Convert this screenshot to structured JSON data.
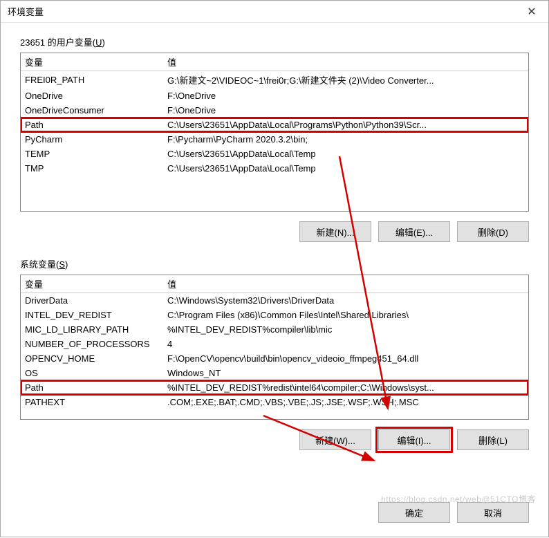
{
  "window": {
    "title": "环境变量"
  },
  "user_section": {
    "label_prefix": "23651 的用户变量(",
    "label_hotkey": "U",
    "label_suffix": ")",
    "header_var": "变量",
    "header_val": "值",
    "rows": [
      {
        "var": "FREI0R_PATH",
        "val": "G:\\新建文~2\\VIDEOC~1\\frei0r;G:\\新建文件夹 (2)\\Video Converter...",
        "hl": false
      },
      {
        "var": "OneDrive",
        "val": "F:\\OneDrive",
        "hl": false
      },
      {
        "var": "OneDriveConsumer",
        "val": "F:\\OneDrive",
        "hl": false
      },
      {
        "var": "Path",
        "val": "C:\\Users\\23651\\AppData\\Local\\Programs\\Python\\Python39\\Scr...",
        "hl": true
      },
      {
        "var": "PyCharm",
        "val": "F:\\Pycharm\\PyCharm 2020.3.2\\bin;",
        "hl": false
      },
      {
        "var": "TEMP",
        "val": "C:\\Users\\23651\\AppData\\Local\\Temp",
        "hl": false
      },
      {
        "var": "TMP",
        "val": "C:\\Users\\23651\\AppData\\Local\\Temp",
        "hl": false
      }
    ],
    "btn_new": "新建(N)...",
    "btn_edit": "编辑(E)...",
    "btn_delete": "删除(D)"
  },
  "sys_section": {
    "label_prefix": "系统变量(",
    "label_hotkey": "S",
    "label_suffix": ")",
    "header_var": "变量",
    "header_val": "值",
    "rows": [
      {
        "var": "DriverData",
        "val": "C:\\Windows\\System32\\Drivers\\DriverData",
        "hl": false
      },
      {
        "var": "INTEL_DEV_REDIST",
        "val": "C:\\Program Files (x86)\\Common Files\\Intel\\Shared Libraries\\",
        "hl": false
      },
      {
        "var": "MIC_LD_LIBRARY_PATH",
        "val": "%INTEL_DEV_REDIST%compiler\\lib\\mic",
        "hl": false
      },
      {
        "var": "NUMBER_OF_PROCESSORS",
        "val": "4",
        "hl": false
      },
      {
        "var": "OPENCV_HOME",
        "val": "F:\\OpenCV\\opencv\\build\\bin\\opencv_videoio_ffmpeg451_64.dll",
        "hl": false
      },
      {
        "var": "OS",
        "val": "Windows_NT",
        "hl": false
      },
      {
        "var": "Path",
        "val": "%INTEL_DEV_REDIST%redist\\intel64\\compiler;C:\\Windows\\syst...",
        "hl": true
      },
      {
        "var": "PATHEXT",
        "val": ".COM;.EXE;.BAT;.CMD;.VBS;.VBE;.JS;.JSE;.WSF;.WSH;.MSC",
        "hl": false
      }
    ],
    "btn_new": "新建(W)...",
    "btn_edit": "编辑(I)...",
    "btn_delete": "删除(L)"
  },
  "footer": {
    "ok": "确定",
    "cancel": "取消"
  },
  "watermark": "https://blog.csdn.net/web@51CTO博客"
}
